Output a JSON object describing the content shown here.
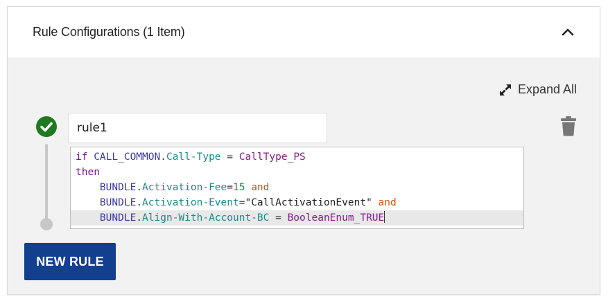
{
  "header": {
    "title": "Rule Configurations (1 Item)",
    "collapse_icon": "chevron-up-icon"
  },
  "toolbar": {
    "expand_all_label": "Expand All",
    "expand_icon": "expand-arrows-icon"
  },
  "rule": {
    "status_icon": "check-circle-icon",
    "status_color": "#1f7a1f",
    "name_value": "rule1",
    "delete_icon": "trash-icon",
    "code": [
      [
        {
          "t": "kw",
          "v": "if"
        },
        {
          "t": "op",
          "v": " "
        },
        {
          "t": "obj",
          "v": "CALL_COMMON"
        },
        {
          "t": "op",
          "v": "."
        },
        {
          "t": "fld",
          "v": "Call-Type"
        },
        {
          "t": "op",
          "v": " = "
        },
        {
          "t": "enum",
          "v": "CallType_PS"
        }
      ],
      [
        {
          "t": "kw",
          "v": "then"
        }
      ],
      [
        {
          "t": "op",
          "v": "    "
        },
        {
          "t": "obj",
          "v": "BUNDLE"
        },
        {
          "t": "op",
          "v": "."
        },
        {
          "t": "fld",
          "v": "Activation-Fee"
        },
        {
          "t": "op",
          "v": "="
        },
        {
          "t": "num",
          "v": "15"
        },
        {
          "t": "op",
          "v": " "
        },
        {
          "t": "and",
          "v": "and"
        }
      ],
      [
        {
          "t": "op",
          "v": "    "
        },
        {
          "t": "obj",
          "v": "BUNDLE"
        },
        {
          "t": "op",
          "v": "."
        },
        {
          "t": "fld",
          "v": "Activation-Event"
        },
        {
          "t": "op",
          "v": "="
        },
        {
          "t": "str",
          "v": "\"CallActivationEvent\""
        },
        {
          "t": "op",
          "v": " "
        },
        {
          "t": "and",
          "v": "and"
        }
      ],
      [
        {
          "t": "op",
          "v": "    "
        },
        {
          "t": "obj",
          "v": "BUNDLE"
        },
        {
          "t": "op",
          "v": "."
        },
        {
          "t": "fld",
          "v": "Align-With-Account-BC"
        },
        {
          "t": "op",
          "v": " = "
        },
        {
          "t": "enum",
          "v": "BooleanEnum_TRUE"
        }
      ]
    ]
  },
  "actions": {
    "new_rule_label": "NEW RULE",
    "new_rule_color": "#123f8e"
  }
}
